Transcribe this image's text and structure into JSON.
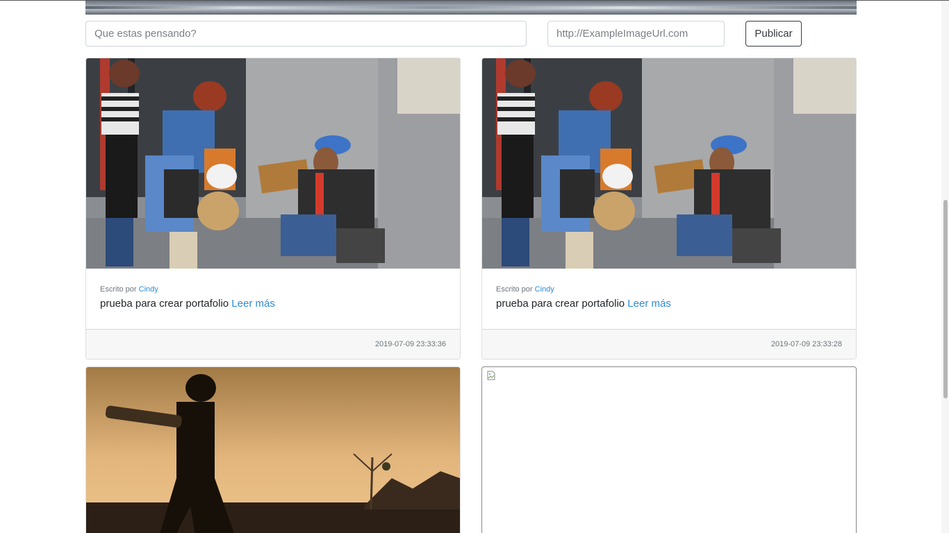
{
  "form": {
    "thought_placeholder": "Que estas pensando?",
    "url_placeholder": "http://ExampleImageUrl.com",
    "publish_label": "Publicar"
  },
  "posts": [
    {
      "written_by": "Escrito por",
      "author": "Cindy",
      "text": "prueba para crear portafolio",
      "read_more": "Leer más",
      "timestamp": "2019-07-09 23:33:36",
      "image": "street-scene-photo"
    },
    {
      "written_by": "Escrito por",
      "author": "Cindy",
      "text": "prueba para crear portafolio",
      "read_more": "Leer más",
      "timestamp": "2019-07-09 23:33:28",
      "image": "street-scene-photo"
    },
    {
      "image": "cricket-silhouette-photo"
    },
    {
      "image": "broken-image-icon"
    }
  ],
  "colors": {
    "link": "#2b8bd8",
    "footer_bg": "#f7f7f7",
    "border": "#ced4da",
    "publish_border": "#343a40"
  }
}
